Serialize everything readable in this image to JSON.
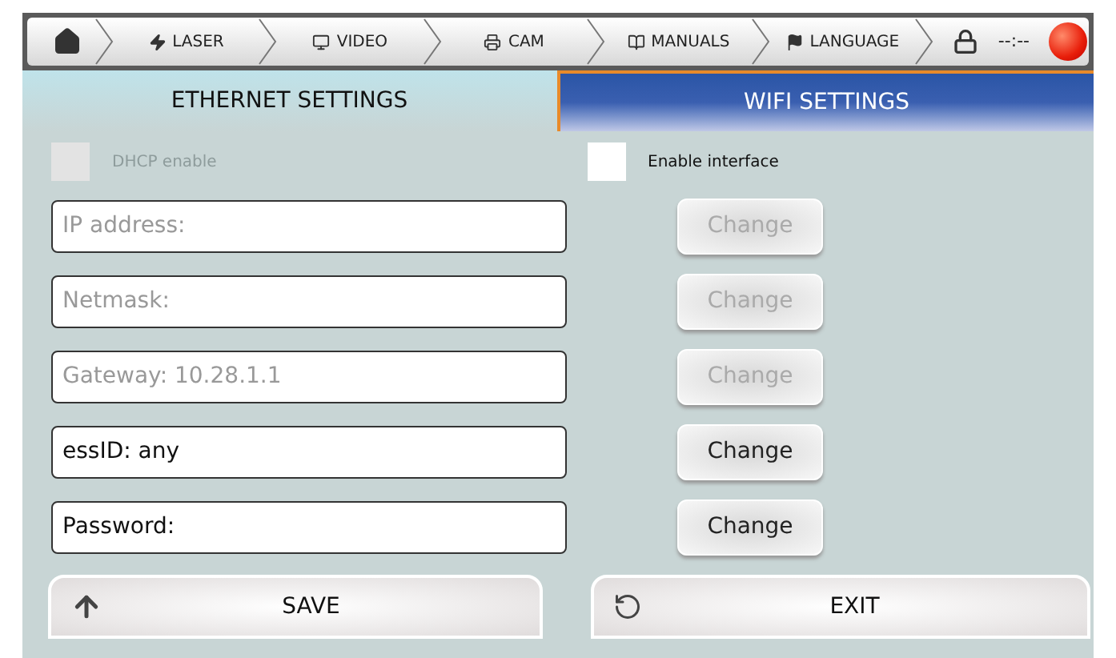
{
  "nav": [
    {
      "kind": "home"
    },
    {
      "kind": "laser",
      "label": "LASER"
    },
    {
      "kind": "video",
      "label": "VIDEO"
    },
    {
      "kind": "cam",
      "label": "CAM"
    },
    {
      "kind": "manuals",
      "label": "MANUALS"
    },
    {
      "kind": "language",
      "label": "LANGUAGE"
    }
  ],
  "clock": "--:--",
  "tabs": [
    {
      "label": "ETHERNET SETTINGS",
      "selected": false
    },
    {
      "label": "WIFI SETTINGS",
      "selected": true
    }
  ],
  "checkboxes": [
    {
      "label": "DHCP enable",
      "checked": false,
      "disabled": true
    },
    {
      "label": "Enable interface",
      "checked": false,
      "disabled": false
    }
  ],
  "rows": [
    {
      "value": "IP address:",
      "disabled": true,
      "button": "Change"
    },
    {
      "value": "Netmask:",
      "disabled": true,
      "button": "Change"
    },
    {
      "value": "Gateway:  10.28.1.1",
      "disabled": true,
      "button": "Change"
    },
    {
      "value": "essID:  any",
      "disabled": false,
      "button": "Change"
    },
    {
      "value": "Password:",
      "disabled": false,
      "button": "Change"
    }
  ],
  "actions": [
    {
      "kind": "save",
      "label": "SAVE"
    },
    {
      "kind": "exit",
      "label": "EXIT"
    }
  ]
}
